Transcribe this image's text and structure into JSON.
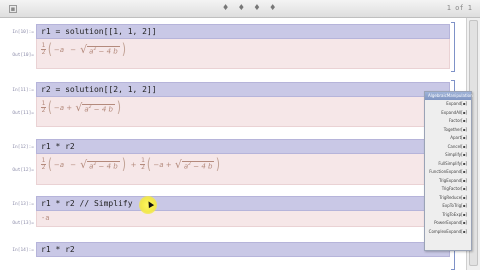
{
  "toolbar": {
    "dots": "♦ ♦ ♦ ♦",
    "page": "1 of 1"
  },
  "cells": [
    {
      "in_label": "In[10]:=",
      "input": "r1 = solution[[1, 1, 2]]",
      "out_label": "Out[10]="
    },
    {
      "in_label": "In[11]:=",
      "input": "r2 = solution[[2, 1, 2]]",
      "out_label": "Out[11]="
    },
    {
      "in_label": "In[12]:=",
      "input": "r1 * r2",
      "out_label": "Out[12]="
    },
    {
      "in_label": "In[13]:=",
      "input": "r1 * r2 // Simplify",
      "out_label": "Out[13]=",
      "output": "-a"
    },
    {
      "in_label": "In[14]:=",
      "input": "r1 * r2"
    }
  ],
  "math": {
    "half_num": "1",
    "half_den": "2",
    "minus_a": "−a ",
    "plus_a": "−a + ",
    "radicand_a": "a",
    "radicand_exp": "2",
    "radicand_rest": " − 4 b",
    "plus": "+",
    "minus": "−"
  },
  "palette": {
    "title": "AlgebraicManipulation",
    "items": [
      "Expand[▪]",
      "ExpandAll[▪]",
      "Factor[▪]",
      "Together[▪]",
      "Apart[▪]",
      "Cancel[▪]",
      "Simplify[▪]",
      "FullSimplify[▪]",
      "FunctionExpand[▪]",
      "TrigExpand[▪]",
      "TrigFactor[▪]",
      "TrigReduce[▪]",
      "ExpToTrig[▪]",
      "TrigToExp[▪]",
      "PowerExpand[▪]",
      "ComplexExpand[▪]"
    ]
  }
}
